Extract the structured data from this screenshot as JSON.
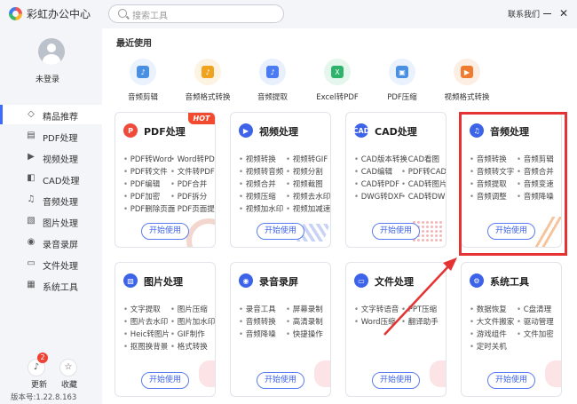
{
  "app": {
    "title": "彩虹办公中心",
    "contact": "联系我们",
    "min_icon": "minimize-icon",
    "close_symbol": "✕"
  },
  "search": {
    "placeholder": "搜索工具"
  },
  "user": {
    "name": "未登录"
  },
  "sidebar": {
    "items": [
      {
        "label": "精品推荐",
        "icon": "◇",
        "active": true
      },
      {
        "label": "PDF处理",
        "icon": "▤"
      },
      {
        "label": "视频处理",
        "icon": "▶"
      },
      {
        "label": "CAD处理",
        "icon": "◧"
      },
      {
        "label": "音频处理",
        "icon": "♫"
      },
      {
        "label": "图片处理",
        "icon": "▧"
      },
      {
        "label": "录音录屏",
        "icon": "◉"
      },
      {
        "label": "文件处理",
        "icon": "▭"
      },
      {
        "label": "系统工具",
        "icon": "▦"
      }
    ],
    "update_label": "更新",
    "update_badge": "2",
    "favorites_label": "收藏",
    "version": "版本号:1.22.8.163"
  },
  "recent": {
    "title": "最近使用",
    "items": [
      {
        "label": "音频剪辑",
        "color": "#4a90e2",
        "bg": "#e9f2fd",
        "glyph": "♪"
      },
      {
        "label": "音频格式转换",
        "color": "#f0a31e",
        "bg": "#fdf3e3",
        "glyph": "♪"
      },
      {
        "label": "音频提取",
        "color": "#4a7bf2",
        "bg": "#e8effd",
        "glyph": "♪"
      },
      {
        "label": "Excel转PDF",
        "color": "#2db36a",
        "bg": "#e5f6ec",
        "glyph": "X"
      },
      {
        "label": "PDF压缩",
        "color": "#4a90e2",
        "bg": "#e9f2fd",
        "glyph": "▣"
      },
      {
        "label": "视频格式转换",
        "color": "#f07a2e",
        "bg": "#fdeee3",
        "glyph": "▶"
      }
    ]
  },
  "start_label": "开始使用",
  "hot_label": "HOT",
  "cards": [
    {
      "title": "PDF处理",
      "icon_color": "#f04b3a",
      "glyph": "P",
      "left": [
        "PDF转Word",
        "PDF转文件",
        "PDF编辑",
        "PDF加密",
        "PDF删除页面"
      ],
      "right": [
        "Word转PDF",
        "文件转PDF",
        "PDF合并",
        "PDF拆分",
        "PDF页面提取"
      ]
    },
    {
      "title": "视频处理",
      "icon_color": "#3d63e8",
      "glyph": "▶",
      "left": [
        "视频转换",
        "视频转音频",
        "视频合并",
        "视频压缩",
        "视频加水印"
      ],
      "right": [
        "视频转GIF",
        "视频分割",
        "视频截图",
        "视频去水印",
        "视频加减速"
      ]
    },
    {
      "title": "CAD处理",
      "icon_color": "#3d63e8",
      "glyph": "CAD",
      "left": [
        "CAD版本转换",
        "CAD编辑",
        "CAD转PDF",
        "DWG转DXF"
      ],
      "right": [
        "CAD看图",
        "PDF转CAD",
        "CAD转图片",
        "CAD转DWF"
      ]
    },
    {
      "title": "音频处理",
      "icon_color": "#3d63e8",
      "glyph": "♫",
      "left": [
        "音频转换",
        "音频转文字",
        "音频提取",
        "音频调整"
      ],
      "right": [
        "音频剪辑",
        "音频合并",
        "音频变速",
        "音频降噪"
      ]
    },
    {
      "title": "图片处理",
      "icon_color": "#3d63e8",
      "glyph": "▧",
      "left": [
        "文字提取",
        "图片去水印",
        "Heic转图片",
        "抠图换背景"
      ],
      "right": [
        "图片压缩",
        "图片加水印",
        "GIF制作",
        "格式转换"
      ]
    },
    {
      "title": "录音录屏",
      "icon_color": "#3d63e8",
      "glyph": "◉",
      "left": [
        "录音工具",
        "音频转换",
        "音频降噪"
      ],
      "right": [
        "屏幕录制",
        "高清录制",
        "快捷操作"
      ]
    },
    {
      "title": "文件处理",
      "icon_color": "#3d63e8",
      "glyph": "▭",
      "left": [
        "文字转语音",
        "Word压缩"
      ],
      "right": [
        "PPT压缩",
        "翻译助手"
      ]
    },
    {
      "title": "系统工具",
      "icon_color": "#3d63e8",
      "glyph": "⚙",
      "left": [
        "数据恢复",
        "大文件搬家",
        "游戏组件",
        "定时关机"
      ],
      "right": [
        "C盘清理",
        "驱动管理",
        "文件加密"
      ]
    }
  ]
}
